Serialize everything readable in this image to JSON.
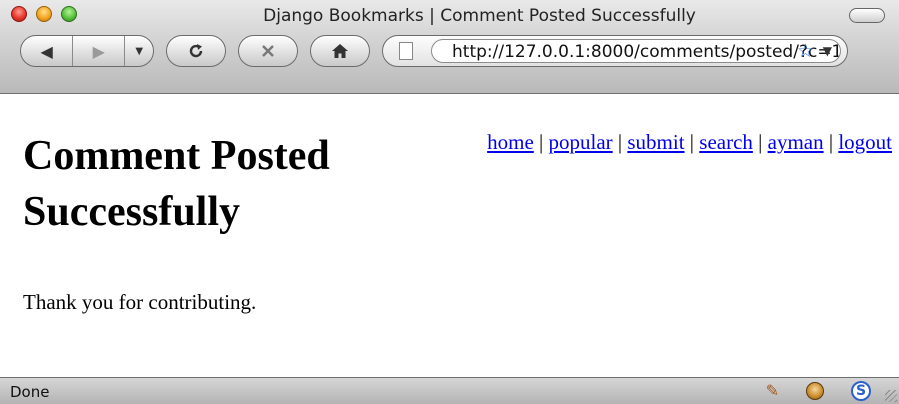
{
  "window": {
    "title": "Django Bookmarks | Comment Posted Successfully"
  },
  "toolbar": {
    "back_icon": "back-arrow-icon",
    "forward_icon": "forward-arrow-icon",
    "history_icon": "chevron-down-icon",
    "reload_icon": "reload-icon",
    "stop_icon": "stop-icon",
    "home_icon": "home-icon"
  },
  "address_bar": {
    "url": "http://127.0.0.1:8000/comments/posted/?c=1"
  },
  "page": {
    "title": "Comment Posted Successfully",
    "message": "Thank you for contributing.",
    "nav": [
      {
        "label": "home"
      },
      {
        "label": "popular"
      },
      {
        "label": "submit"
      },
      {
        "label": "search"
      },
      {
        "label": "ayman"
      },
      {
        "label": "logout"
      }
    ],
    "nav_separator": "|"
  },
  "status_bar": {
    "text": "Done"
  },
  "colors": {
    "link": "#0000ee",
    "bookmark_star": "#3f7fd8"
  }
}
